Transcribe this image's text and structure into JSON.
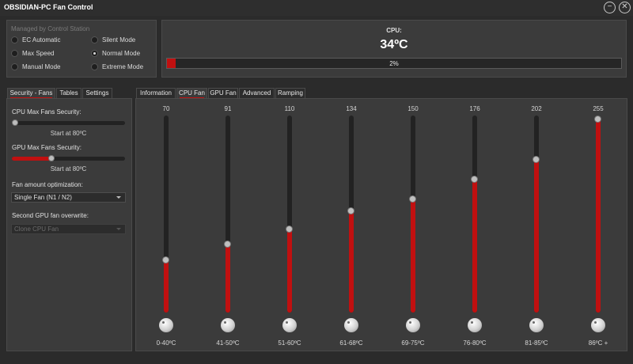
{
  "window": {
    "title": "OBSIDIAN-PC Fan Control",
    "minimize_glyph": "−",
    "close_glyph": "✕"
  },
  "mode_panel": {
    "label": "Managed by Control Station",
    "modes": [
      {
        "label": "EC Automatic",
        "selected": false
      },
      {
        "label": "Silent Mode",
        "selected": false
      },
      {
        "label": "Max Speed",
        "selected": false
      },
      {
        "label": "Normal Mode",
        "selected": true
      },
      {
        "label": "Manual Mode",
        "selected": false
      },
      {
        "label": "Extreme Mode",
        "selected": false
      }
    ]
  },
  "cpu_panel": {
    "label": "CPU:",
    "temperature": "34ºC",
    "fan_percent_label": "2%",
    "fan_percent": 2
  },
  "left_tabs": [
    {
      "label": "Security - Fans",
      "active": true
    },
    {
      "label": "Tables",
      "active": false
    },
    {
      "label": "Settings",
      "active": false
    }
  ],
  "security": {
    "cpu_label": "CPU Max Fans Security:",
    "cpu_value": 0,
    "cpu_note": "Start at 80ºC",
    "gpu_label": "GPU Max Fans Security:",
    "gpu_value": 0.35,
    "gpu_note": "Start at 80ºC",
    "fan_amount_label": "Fan amount optimization:",
    "fan_amount_value": "Single Fan (N1 / N2)",
    "second_gpu_label": "Second GPU fan overwrite:",
    "second_gpu_value": "Clone CPU Fan"
  },
  "right_tabs": [
    {
      "label": "Information",
      "active": false
    },
    {
      "label": "CPU Fan",
      "active": true
    },
    {
      "label": "GPU Fan",
      "active": false
    },
    {
      "label": "Advanced",
      "active": false
    },
    {
      "label": "Ramping",
      "active": false
    }
  ],
  "fan_curve": {
    "max_value": 255,
    "points": [
      {
        "value": 70,
        "range": "0-40ºC"
      },
      {
        "value": 91,
        "range": "41-50ºC"
      },
      {
        "value": 110,
        "range": "51-60ºC"
      },
      {
        "value": 134,
        "range": "61-68ºC"
      },
      {
        "value": 150,
        "range": "69-75ºC"
      },
      {
        "value": 176,
        "range": "76-80ºC"
      },
      {
        "value": 202,
        "range": "81-85ºC"
      },
      {
        "value": 255,
        "range": "86ºC +"
      }
    ]
  },
  "colors": {
    "accent": "#c01010",
    "background": "#2b2b2b",
    "panel": "#3b3b3b"
  }
}
